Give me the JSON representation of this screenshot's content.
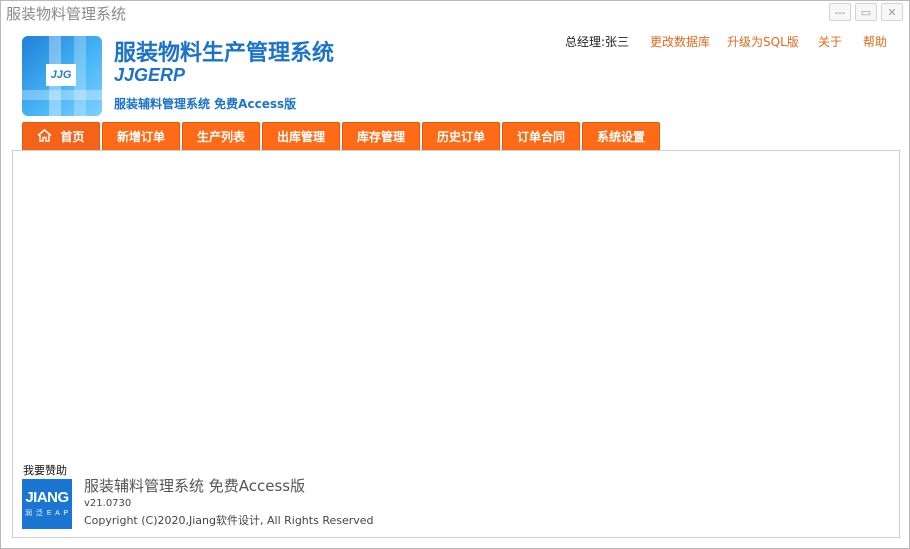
{
  "window": {
    "title": "服装物料管理系统",
    "controls": [
      "—",
      "▭",
      "✕"
    ]
  },
  "header": {
    "app_title": "服装物料生产管理系统",
    "app_subtitle": "JJGERP",
    "edition": "服装辅料管理系统 免费Access版",
    "logo_text": "JJG"
  },
  "top_links": {
    "user": "总经理:张三",
    "change_db": "更改数据库",
    "upgrade": "升级为SQL版",
    "about": "关于",
    "help": "帮助"
  },
  "tabs": [
    {
      "label": "首页",
      "icon": "home-icon"
    },
    {
      "label": "新增订单"
    },
    {
      "label": "生产列表"
    },
    {
      "label": "出库管理"
    },
    {
      "label": "库存管理"
    },
    {
      "label": "历史订单"
    },
    {
      "label": "订单合同"
    },
    {
      "label": "系统设置"
    }
  ],
  "footer": {
    "sponsor_label": "我要赞助",
    "sponsor_logo_big": "JIANG",
    "sponsor_logo_small": "润 泛 E A P",
    "title": "服装辅料管理系统  免费Access版",
    "version": "v21.0730",
    "copyright": "Copyright (C)2020,Jiang软件设计, All Rights Reserved"
  },
  "colors": {
    "brand_blue": "#1c73c9",
    "tab_orange": "#ff6a16",
    "link_orange": "#e26a1c"
  }
}
